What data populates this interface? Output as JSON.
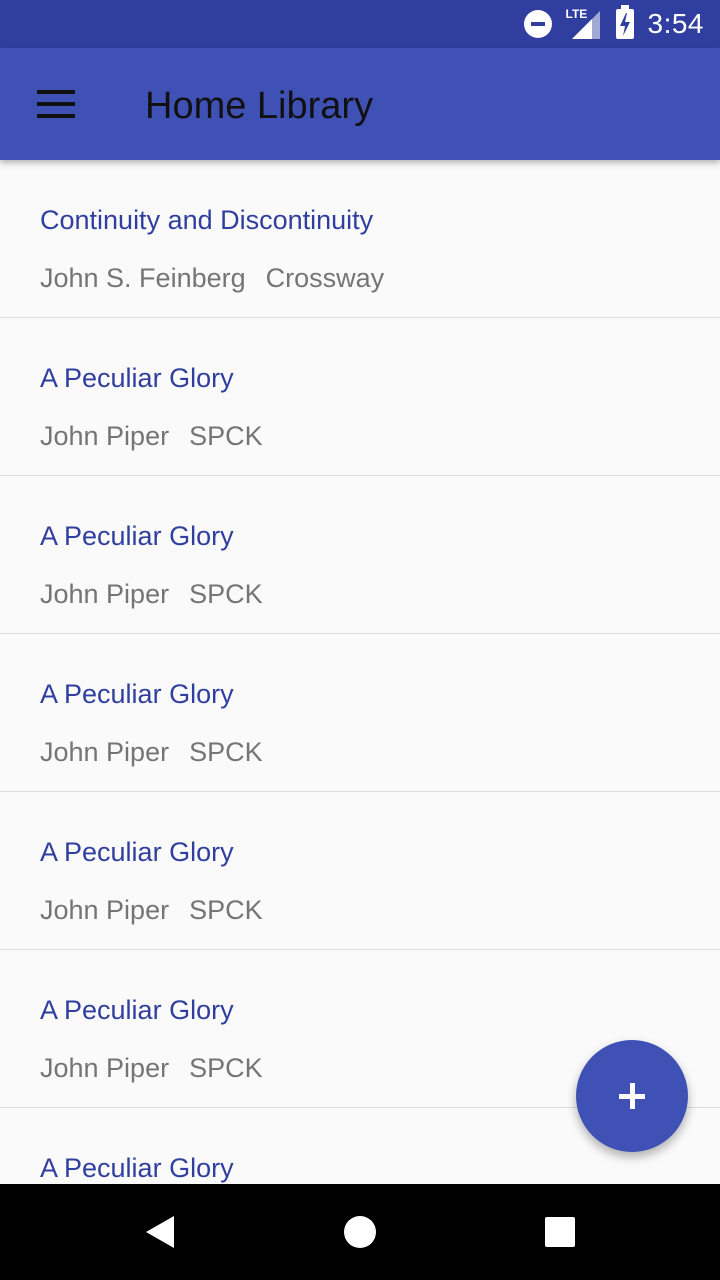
{
  "status_bar": {
    "time": "3:54",
    "network": "LTE",
    "icons": [
      "do-not-disturb-icon",
      "lte-signal-icon",
      "battery-charging-icon"
    ]
  },
  "app_bar": {
    "title": "Home Library",
    "menu_icon": "menu-icon"
  },
  "books": [
    {
      "title": "Continuity and Discontinuity",
      "author": "John S. Feinberg",
      "publisher": "Crossway"
    },
    {
      "title": "A Peculiar Glory",
      "author": "John Piper",
      "publisher": "SPCK"
    },
    {
      "title": "A Peculiar Glory",
      "author": "John Piper",
      "publisher": "SPCK"
    },
    {
      "title": "A Peculiar Glory",
      "author": "John Piper",
      "publisher": "SPCK"
    },
    {
      "title": "A Peculiar Glory",
      "author": "John Piper",
      "publisher": "SPCK"
    },
    {
      "title": "A Peculiar Glory",
      "author": "John Piper",
      "publisher": "SPCK"
    },
    {
      "title": "A Peculiar Glory",
      "author": "",
      "publisher": ""
    }
  ],
  "fab": {
    "icon": "plus-icon"
  },
  "nav_bar": {
    "icons": [
      "back-icon",
      "home-icon",
      "recents-icon"
    ]
  },
  "colors": {
    "primary": "#3f51b5",
    "primary_dark": "#303f9f",
    "title_text": "#303f9f",
    "secondary_text": "#757575",
    "background": "#fafafa"
  }
}
